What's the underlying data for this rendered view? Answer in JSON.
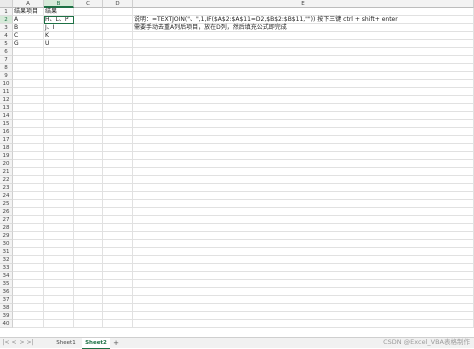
{
  "columns": [
    "A",
    "B",
    "C",
    "D",
    "E"
  ],
  "row_count": 40,
  "cells": {
    "A1": "结果项目",
    "B1": "结果",
    "A2": "A",
    "B2": "H、L、P",
    "A3": "B",
    "B3": "J、I",
    "A4": "C",
    "B4": "K",
    "A5": "G",
    "B5": "U",
    "E2": "说明：=TEXTJOIN(\"、\",1,IF($A$2:$A$11=D2,$B$2:$B$11,\"\"))    按下三键  ctrl + shift+ enter",
    "E3": "需要手动去重A列后项目，放在D列，然后填充公式即完成"
  },
  "active_cell": {
    "column": "B",
    "row": 2
  },
  "sheet_tabs": [
    {
      "label": "Sheet1",
      "active": false
    },
    {
      "label": "Sheet2",
      "active": true
    }
  ],
  "add_sheet_label": "+",
  "nav_buttons": [
    "|<",
    "<",
    ">",
    ">|"
  ],
  "watermark": "CSDN @Excel_VBA表格制作",
  "colors": {
    "accent": "#1e7145",
    "grid_line": "#e1e1e1",
    "header_bg": "#f3f3f3"
  }
}
